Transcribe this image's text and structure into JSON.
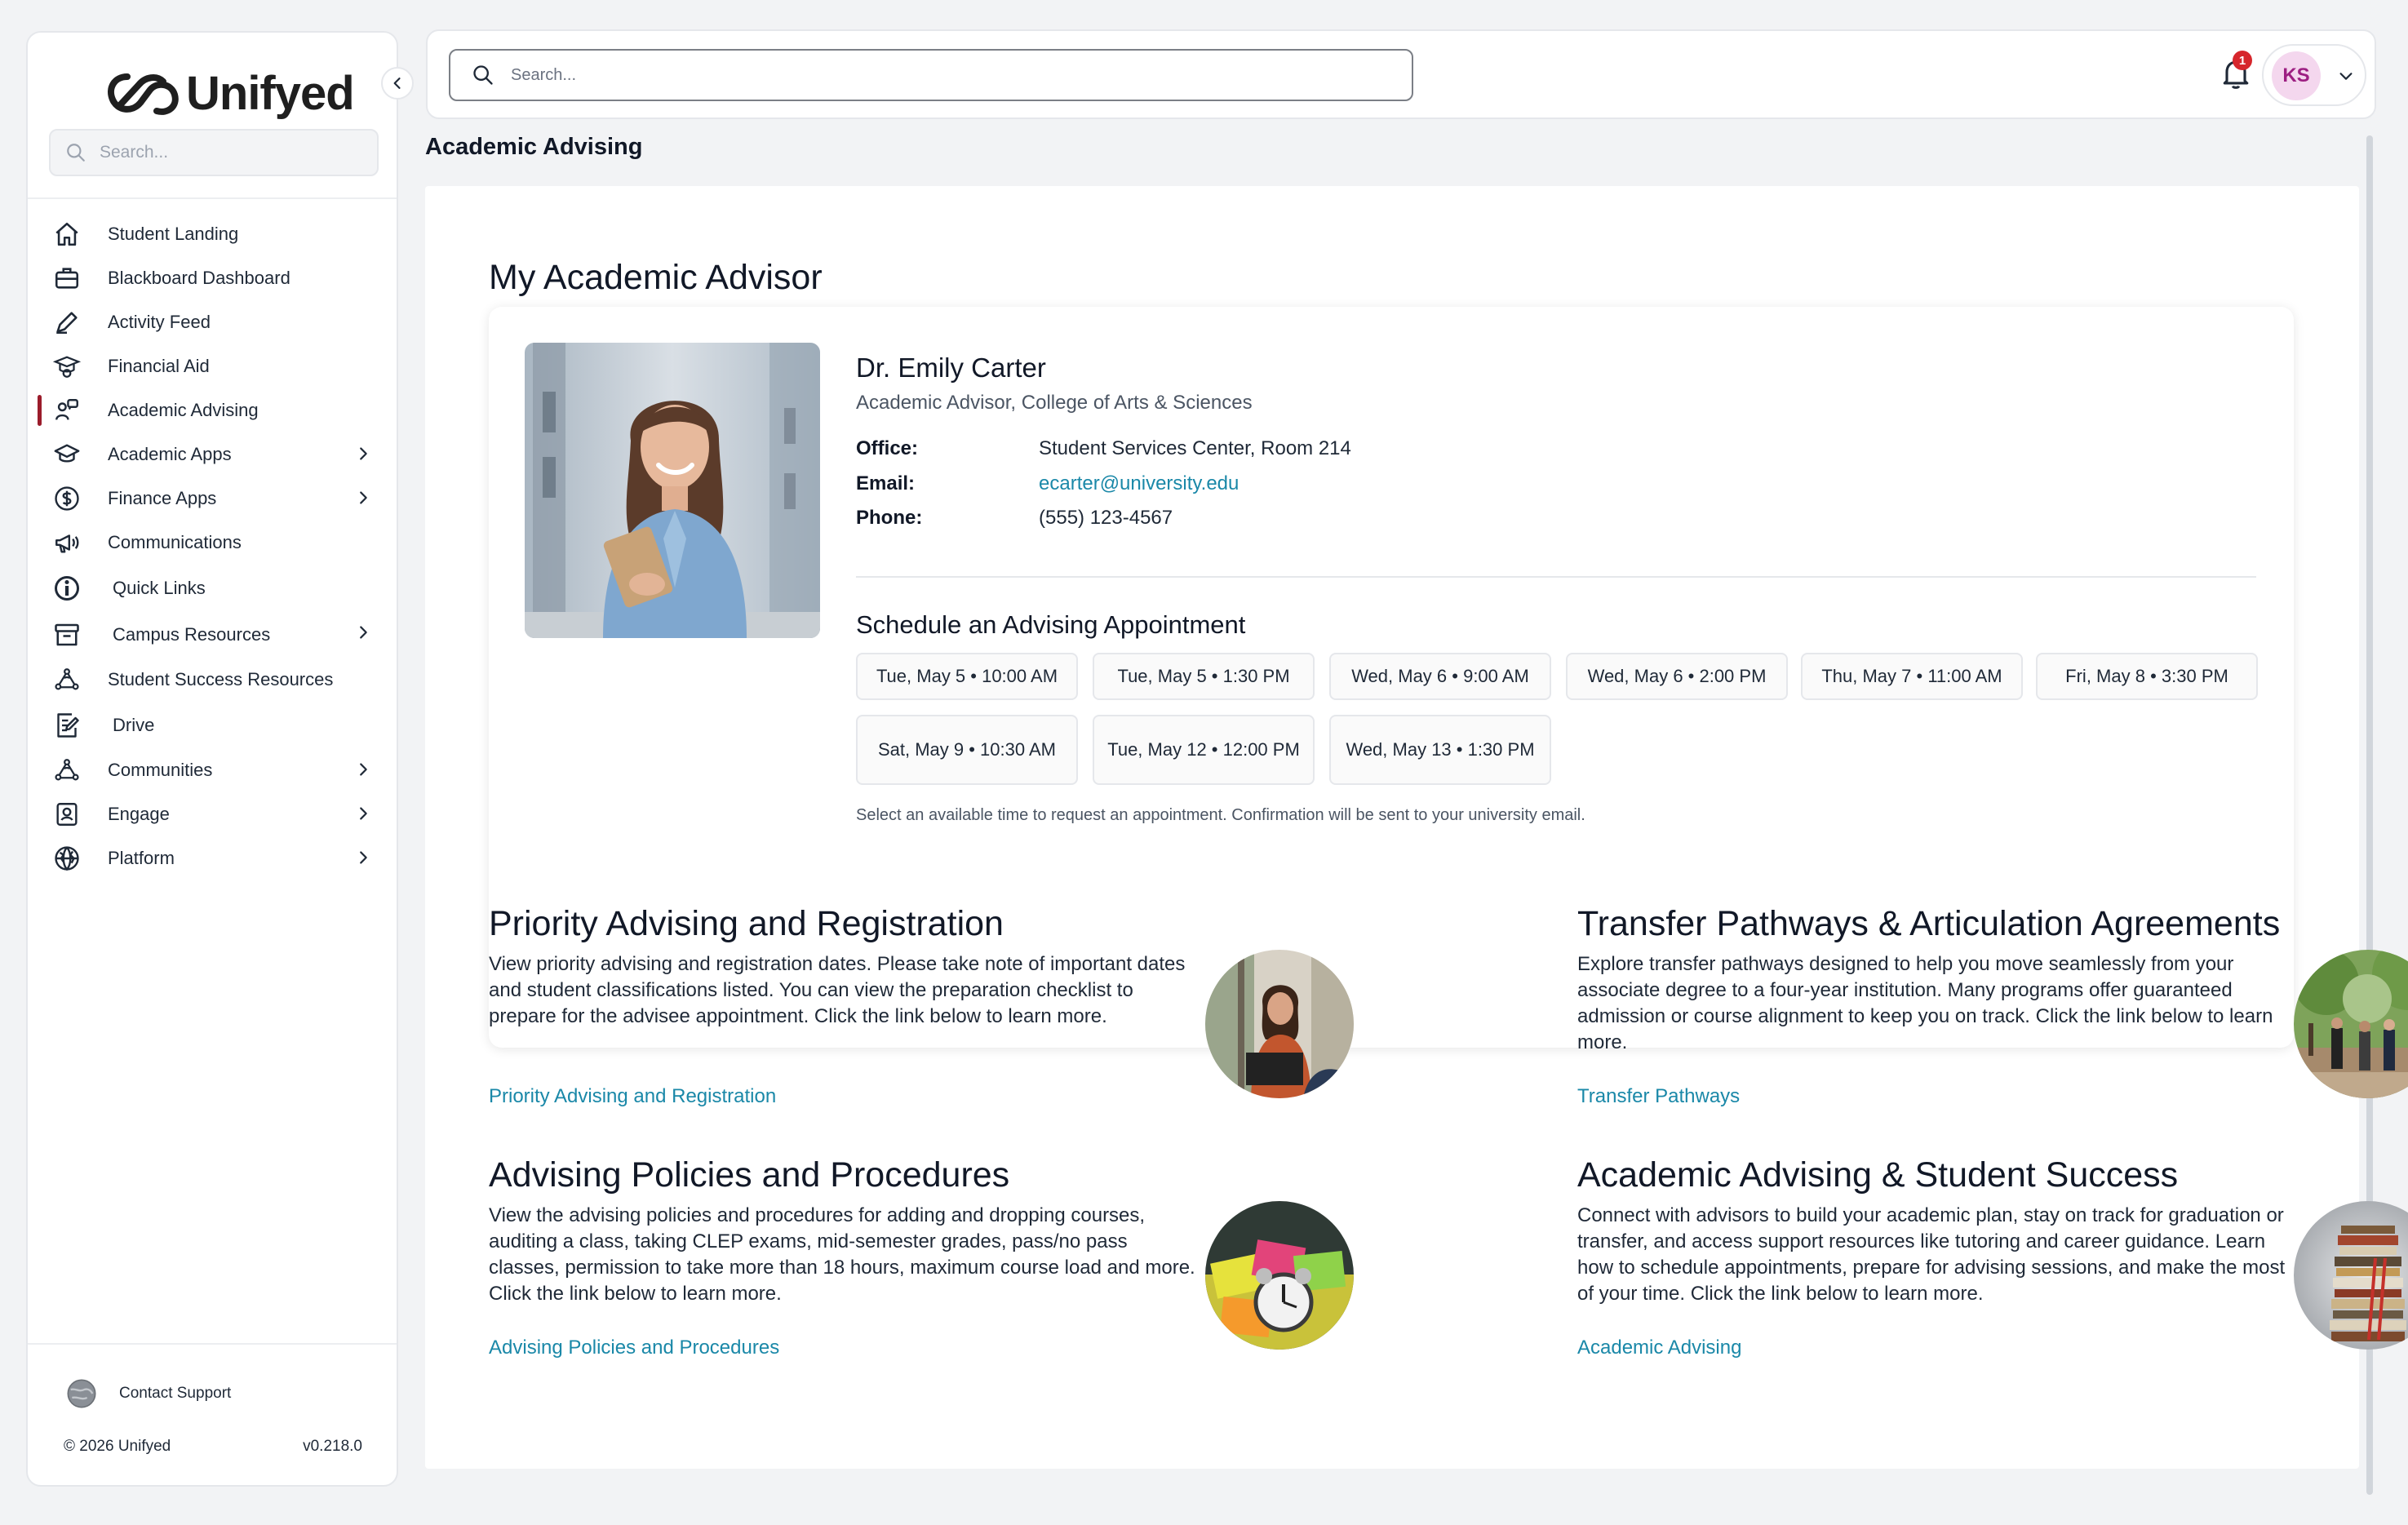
{
  "brand": {
    "name": "Unifyed"
  },
  "sidebar": {
    "search_placeholder": "Search...",
    "items": [
      {
        "label": "Student Landing",
        "icon": "home-icon"
      },
      {
        "label": "Blackboard Dashboard",
        "icon": "briefcase-icon"
      },
      {
        "label": "Activity Feed",
        "icon": "pen-icon"
      },
      {
        "label": "Financial Aid",
        "icon": "graduation-money-icon"
      },
      {
        "label": "Academic Advising",
        "icon": "advising-icon",
        "active": true
      },
      {
        "label": "Academic Apps",
        "icon": "mortarboard-icon",
        "has_children": true
      },
      {
        "label": "Finance Apps",
        "icon": "dollar-icon",
        "has_children": true
      },
      {
        "label": "Communications",
        "icon": "megaphone-icon"
      },
      {
        "label": "Quick Links",
        "icon": "info-circle-icon"
      },
      {
        "label": "Campus Resources",
        "icon": "archive-box-icon",
        "has_children": true
      },
      {
        "label": "Student Success Resources",
        "icon": "people-network-icon"
      },
      {
        "label": "Drive",
        "icon": "document-edit-icon"
      },
      {
        "label": "Communities",
        "icon": "people-network-icon",
        "has_children": true
      },
      {
        "label": "Engage",
        "icon": "id-badge-icon",
        "has_children": true
      },
      {
        "label": "Platform",
        "icon": "globe-icon",
        "has_children": true
      }
    ],
    "contact_support": "Contact Support",
    "copyright": "© 2026 Unifyed",
    "version": "v0.218.0"
  },
  "topbar": {
    "search_placeholder": "Search...",
    "notification_count": "1",
    "user_initials": "KS"
  },
  "page": {
    "title": "Academic Advising",
    "advisor_section_title": "My Academic Advisor",
    "advisor": {
      "name": "Dr. Emily Carter",
      "role": "Academic Advisor, College of Arts & Sciences",
      "office_label": "Office:",
      "office": "Student Services Center, Room 214",
      "email_label": "Email:",
      "email": "ecarter@university.edu",
      "phone_label": "Phone:",
      "phone": "(555) 123-4567"
    },
    "schedule": {
      "title": "Schedule an Advising Appointment",
      "slots": [
        "Tue, May 5 • 10:00 AM",
        "Tue, May 5 • 1:30 PM",
        "Wed, May 6 • 9:00 AM",
        "Wed, May 6 • 2:00 PM",
        "Thu, May 7 • 11:00 AM",
        "Fri, May 8 • 3:30 PM",
        "Sat, May 9 • 10:30 AM",
        "Tue, May 12 • 12:00 PM",
        "Wed, May 13 • 1:30 PM"
      ],
      "note": "Select an available time to request an appointment. Confirmation will be sent to your university email."
    },
    "features": [
      {
        "title": "Priority Advising and Registration",
        "body": "View priority advising and registration dates. Please take note of important dates and student classifications listed. You can view the preparation checklist to prepare for the advisee appointment. Click the link below to learn more.",
        "link": "Priority Advising and Registration"
      },
      {
        "title": "Transfer Pathways & Articulation Agreements",
        "body": "Explore transfer pathways designed to help you move seamlessly from your associate degree to a four-year institution. Many programs offer guaranteed admission or course alignment to keep you on track. Click the link below to learn more.",
        "link": "Transfer Pathways"
      },
      {
        "title": "Advising Policies and Procedures",
        "body": "View the advising policies and procedures for adding and dropping courses, auditing a class, taking CLEP exams, mid-semester grades, pass/no pass classes, permission to take more than 18 hours, maximum course load and more. Click the link below to learn more.",
        "link": "Advising Policies and Procedures"
      },
      {
        "title": "Academic Advising & Student Success",
        "body": "Connect with advisors to build your academic plan, stay on track for graduation or transfer, and access support resources like tutoring and career guidance. Learn how to schedule appointments, prepare for advising sessions, and make the most of your time. Click the link below to learn more.",
        "link": "Academic Advising"
      }
    ]
  },
  "colors": {
    "accent_link": "#1a88a8",
    "active_indicator": "#9b1c2b",
    "badge": "#d6262c",
    "avatar_bg": "#f4d7ee",
    "avatar_text": "#9d1f82"
  }
}
